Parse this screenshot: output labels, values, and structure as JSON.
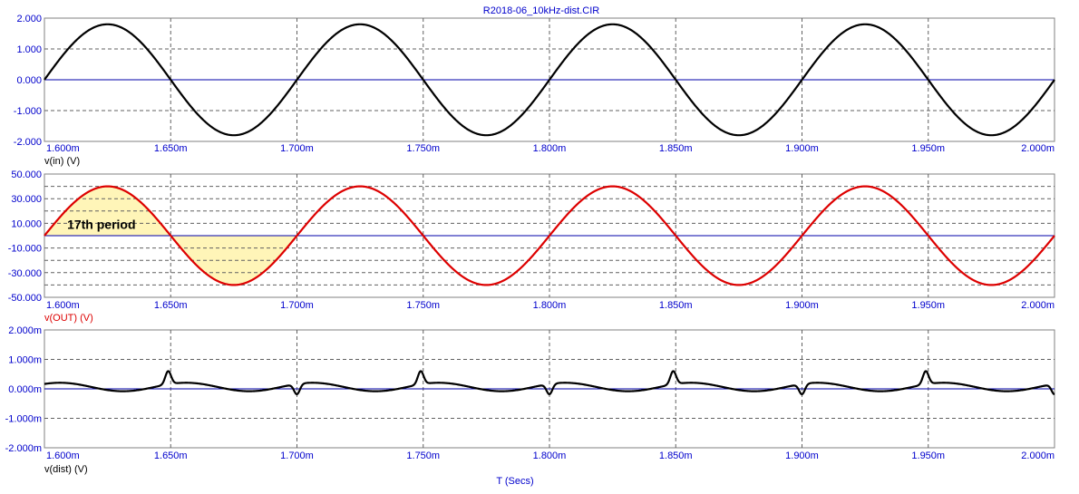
{
  "window": {
    "title": "R2018-06_10kHz-dist.CIR",
    "x_axis_label": "T (Secs)"
  },
  "colors": {
    "tick_text": "#0000cc",
    "zero_line": "#0000aa",
    "trace_vin": "#000000",
    "trace_vout": "#dd0000",
    "trace_dist": "#000000",
    "shade": "#fff5b8",
    "grid": "#606060"
  },
  "chart_data": [
    {
      "type": "line",
      "name": "v(in)",
      "ylabel": "v(in) (V)",
      "xlim": [
        0.0016,
        0.002
      ],
      "ylim": [
        -2.0,
        2.0
      ],
      "x_ticks": [
        "1.600m",
        "1.650m",
        "1.700m",
        "1.750m",
        "1.800m",
        "1.850m",
        "1.900m",
        "1.950m",
        "2.000m"
      ],
      "y_ticks": [
        "2.000",
        "1.000",
        "0.000",
        "-1.000",
        "-2.000"
      ],
      "y_tick_values": [
        2,
        1,
        0,
        -1,
        -2
      ],
      "y_grid_values": [
        2,
        1,
        0,
        -1,
        -2
      ],
      "series": [
        {
          "name": "v(in)",
          "color": "#000000",
          "waveform": "sine",
          "amplitude": 1.8,
          "frequency_hz": 10000,
          "phase": 0
        }
      ],
      "grid": true
    },
    {
      "type": "line",
      "name": "v(OUT)",
      "ylabel": "v(OUT) (V)",
      "xlim": [
        0.0016,
        0.002
      ],
      "ylim": [
        -50,
        50
      ],
      "x_ticks": [
        "1.600m",
        "1.650m",
        "1.700m",
        "1.750m",
        "1.800m",
        "1.850m",
        "1.900m",
        "1.950m",
        "2.000m"
      ],
      "y_ticks": [
        "50.000",
        "30.000",
        "10.000",
        "-10.000",
        "-30.000",
        "-50.000"
      ],
      "y_tick_values": [
        50,
        30,
        10,
        -10,
        -30,
        -50
      ],
      "y_grid_values": [
        50,
        40,
        30,
        20,
        10,
        0,
        -10,
        -20,
        -30,
        -40,
        -50
      ],
      "series": [
        {
          "name": "v(OUT)",
          "color": "#dd0000",
          "waveform": "sine",
          "amplitude": 40,
          "frequency_hz": 10000,
          "phase": 0
        }
      ],
      "shaded_region": {
        "x_start": 0.0016,
        "x_end": 0.0017
      },
      "annotation": {
        "text": "17th period",
        "x": 0.001609,
        "y": 10
      },
      "grid": true
    },
    {
      "type": "line",
      "name": "v(dist)",
      "ylabel": "v(dist) (V)",
      "xlim": [
        0.0016,
        0.002
      ],
      "ylim": [
        -0.002,
        0.002
      ],
      "x_ticks": [
        "1.600m",
        "1.650m",
        "1.700m",
        "1.750m",
        "1.800m",
        "1.850m",
        "1.900m",
        "1.950m",
        "2.000m"
      ],
      "y_ticks": [
        "2.000m",
        "1.000m",
        "0.000m",
        "-1.000m",
        "-2.000m"
      ],
      "y_tick_values": [
        0.002,
        0.001,
        0,
        -0.001,
        -0.002
      ],
      "y_grid_values": [
        0.002,
        0.001,
        0,
        -0.001,
        -0.002
      ],
      "series": [
        {
          "name": "v(dist)",
          "color": "#000000",
          "waveform": "distortion",
          "bump_amplitude": 0.00018,
          "spikes": [
            {
              "x": 0.001649,
              "y": 0.00045
            },
            {
              "x": 0.0017,
              "y": -0.00035
            },
            {
              "x": 0.001749,
              "y": 0.00045
            },
            {
              "x": 0.0018,
              "y": -0.00035
            },
            {
              "x": 0.001849,
              "y": 0.00045
            },
            {
              "x": 0.0019,
              "y": -0.00035
            },
            {
              "x": 0.001949,
              "y": 0.00045
            },
            {
              "x": 0.002,
              "y": -0.00035
            }
          ]
        }
      ],
      "grid": true
    }
  ]
}
